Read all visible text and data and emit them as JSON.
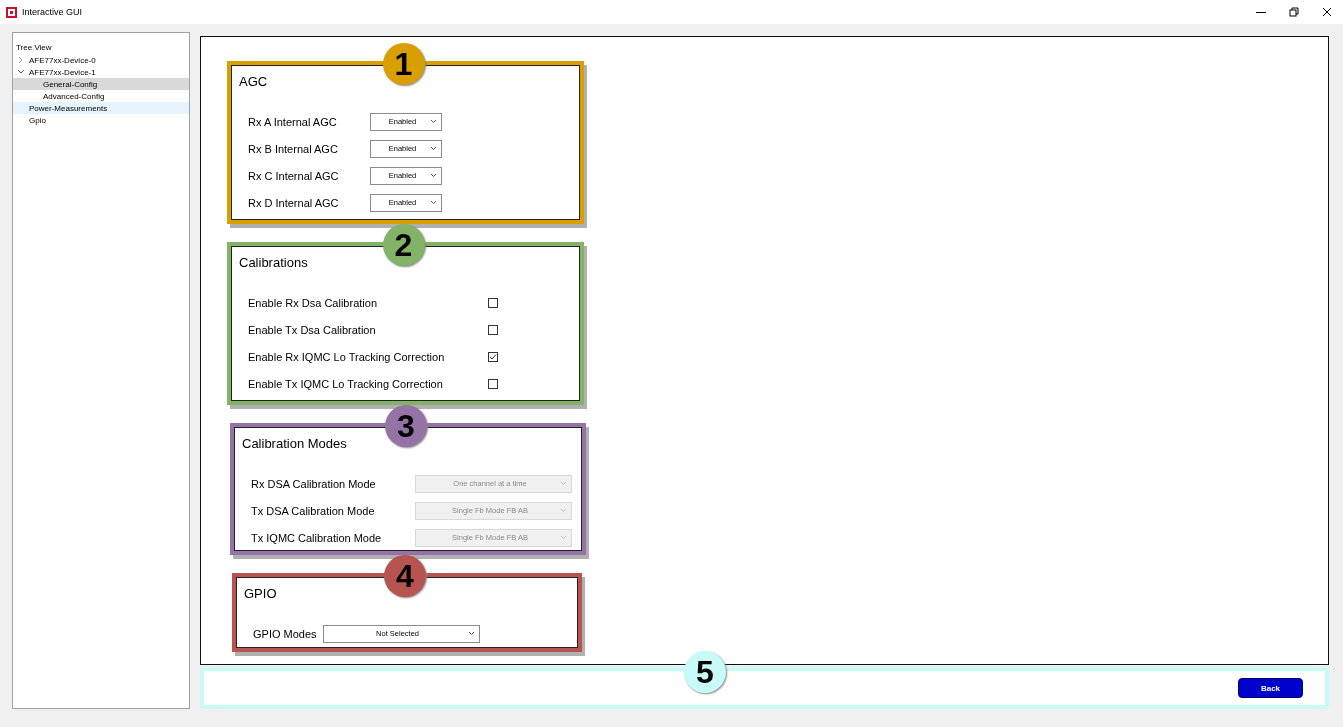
{
  "window": {
    "title": "Interactive GUI"
  },
  "tree": {
    "title": "Tree View",
    "items": [
      {
        "label": "AFE77xx-Device-0",
        "expanded": false,
        "selected": false,
        "hovered": false
      },
      {
        "label": "AFE77xx-Device-1",
        "expanded": true,
        "selected": false,
        "hovered": false,
        "children": [
          {
            "label": "General-Config",
            "selected": true,
            "hovered": false
          },
          {
            "label": "Advanced-Config",
            "selected": false,
            "hovered": false
          }
        ]
      },
      {
        "label": "Power-Measurements",
        "selected": false,
        "hovered": true
      },
      {
        "label": "Gpio",
        "selected": false,
        "hovered": false
      }
    ]
  },
  "sections": [
    {
      "title": "AGC",
      "badge": "1",
      "color": "#d99e00",
      "rows": [
        {
          "kind": "dropdown",
          "label": "Rx A Internal AGC",
          "value": "Enabled",
          "disabled": false
        },
        {
          "kind": "dropdown",
          "label": "Rx B Internal AGC",
          "value": "Enabled",
          "disabled": false
        },
        {
          "kind": "dropdown",
          "label": "Rx C Internal AGC",
          "value": "Enabled",
          "disabled": false
        },
        {
          "kind": "dropdown",
          "label": "Rx D Internal AGC",
          "value": "Enabled",
          "disabled": false
        }
      ]
    },
    {
      "title": "Calibrations",
      "badge": "2",
      "color": "#82b366",
      "rows": [
        {
          "kind": "checkbox",
          "label": "Enable Rx Dsa Calibration",
          "checked": false
        },
        {
          "kind": "checkbox",
          "label": "Enable Tx Dsa Calibration",
          "checked": false
        },
        {
          "kind": "checkbox",
          "label": "Enable Rx IQMC Lo Tracking Correction",
          "checked": true
        },
        {
          "kind": "checkbox",
          "label": "Enable Tx IQMC Lo Tracking Correction",
          "checked": false
        }
      ]
    },
    {
      "title": "Calibration Modes",
      "badge": "3",
      "color": "#9673a6",
      "rows": [
        {
          "kind": "dropdown",
          "label": "Rx DSA Calibration Mode",
          "value": "One channel at a time",
          "disabled": true
        },
        {
          "kind": "dropdown",
          "label": "Tx DSA Calibration Mode",
          "value": "Single Fb Mode FB AB",
          "disabled": true
        },
        {
          "kind": "dropdown",
          "label": "Tx IQMC Calibration Mode",
          "value": "Single Fb Mode FB AB",
          "disabled": true
        }
      ]
    },
    {
      "title": "GPIO",
      "badge": "4",
      "color": "#b85450",
      "rows": [
        {
          "kind": "dropdown",
          "label": "GPIO Modes",
          "value": "Not Selected",
          "disabled": false
        }
      ]
    }
  ],
  "footer": {
    "badge": "5",
    "color": "#c8fafa",
    "button": "Back"
  }
}
